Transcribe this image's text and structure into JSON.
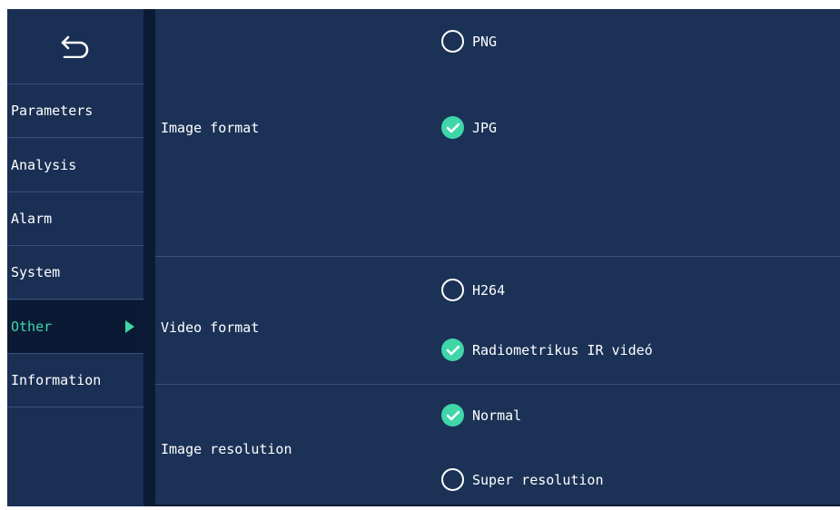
{
  "sidebar": {
    "back_icon": "back-arrow-icon",
    "items": [
      {
        "label": "Parameters",
        "active": false
      },
      {
        "label": "Analysis",
        "active": false
      },
      {
        "label": "Alarm",
        "active": false
      },
      {
        "label": "System",
        "active": false
      },
      {
        "label": "Other",
        "active": true
      },
      {
        "label": "Information",
        "active": false
      }
    ]
  },
  "sections": [
    {
      "label": "Image format",
      "options": [
        {
          "label": "PNG",
          "checked": false
        },
        {
          "label": "JPG",
          "checked": true
        }
      ]
    },
    {
      "label": "Video format",
      "options": [
        {
          "label": "H264",
          "checked": false
        },
        {
          "label": "Radiometrikus IR videó",
          "checked": true
        }
      ]
    },
    {
      "label": "Image resolution",
      "options": [
        {
          "label": "Normal",
          "checked": true
        },
        {
          "label": "Super resolution",
          "checked": false
        }
      ]
    }
  ],
  "colors": {
    "background": "#1b3156",
    "sidebar": "#1a2f54",
    "active_bg": "#0b1a34",
    "accent": "#3fd6a8",
    "text": "#ffffff"
  }
}
